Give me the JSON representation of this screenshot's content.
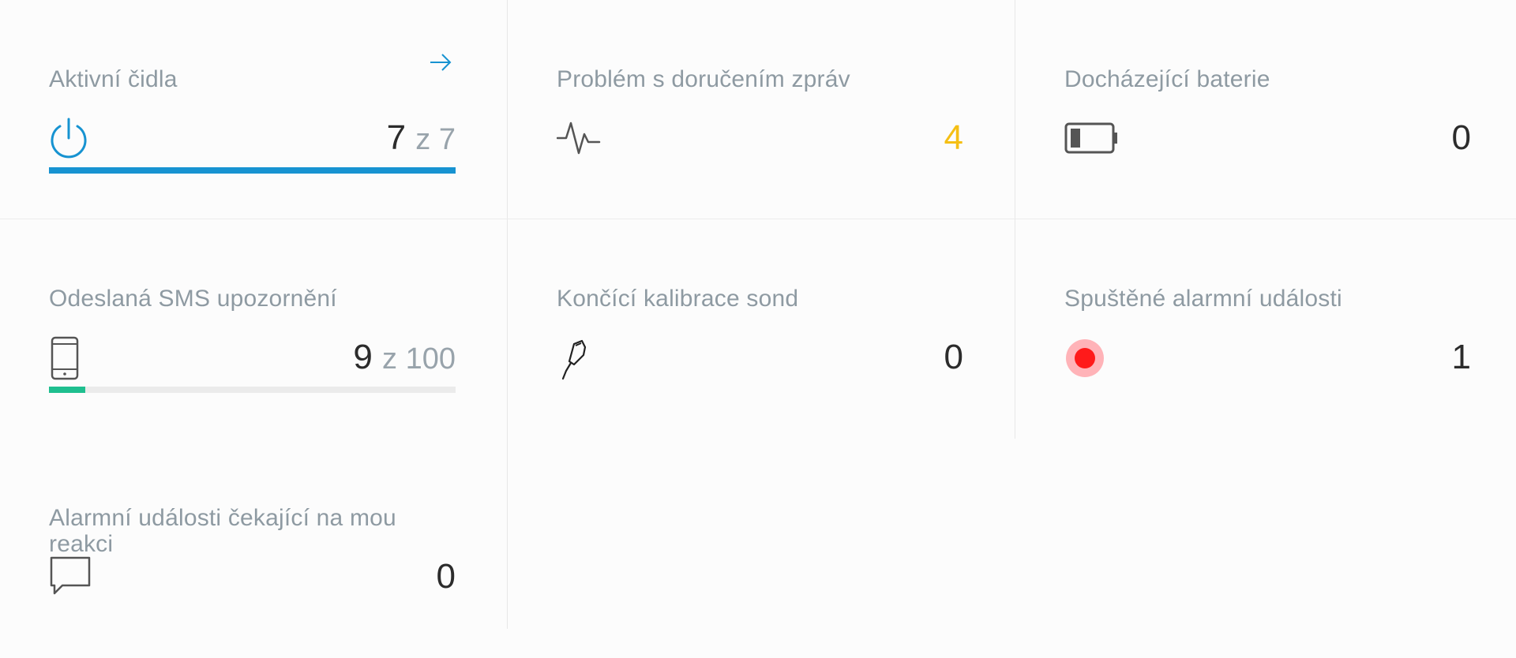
{
  "cards": [
    {
      "title": "Aktivní čidla",
      "icon": "power-icon",
      "value": "7",
      "of_label": "z 7",
      "progress": 1.0,
      "progress_color": "#1793d1",
      "has_link": true
    },
    {
      "title": "Problém s doručením zpráv",
      "icon": "pulse-icon",
      "value": "4",
      "value_color": "#f5bf14"
    },
    {
      "title": "Docházející baterie",
      "icon": "battery-low-icon",
      "value": "0"
    },
    {
      "title": "Odeslaná SMS upozornění",
      "icon": "phone-icon",
      "value": "9",
      "of_label": "z 100",
      "progress": 0.09,
      "progress_color": "#1fbf8f"
    },
    {
      "title": "Končící kalibrace sond",
      "icon": "probe-icon",
      "value": "0"
    },
    {
      "title": "Spuštěné alarmní události",
      "icon": "alarm-dot-icon",
      "value": "1",
      "alarm_color": "#ff1a1a"
    },
    {
      "title": "Alarmní události čekající na mou reakci",
      "icon": "chat-bubble-icon",
      "value": "0"
    }
  ]
}
